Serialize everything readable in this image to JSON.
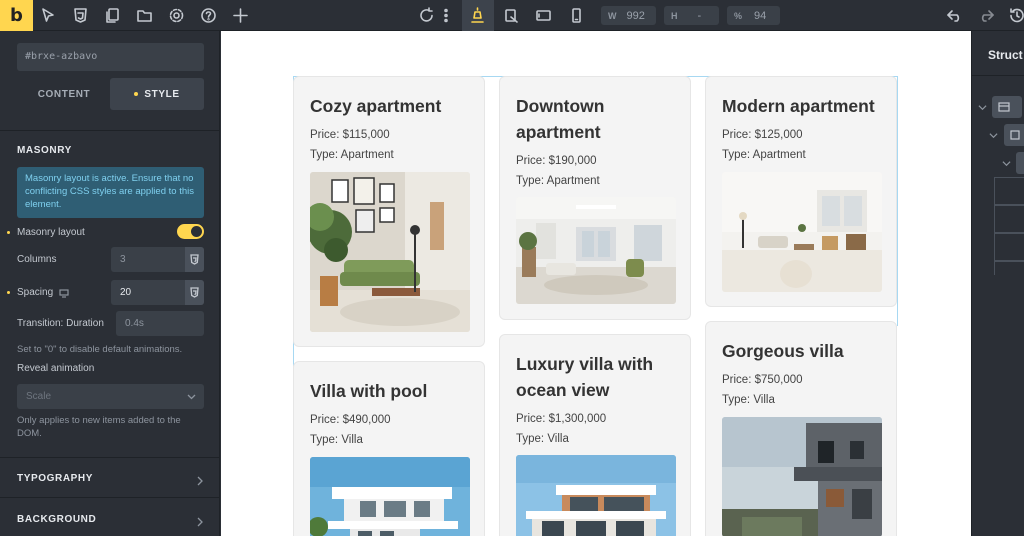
{
  "toolbar": {
    "logo": "b",
    "width_label": "W",
    "width_value": "992",
    "height_label": "H",
    "height_value": "-",
    "percent_label": "%",
    "percent_value": "94"
  },
  "left_panel": {
    "element_id": "#brxe-azbavo",
    "tabs": {
      "content": "CONTENT",
      "style": "STYLE"
    },
    "section_masonry": "MASONRY",
    "notice": "Masonry layout is active. Ensure that no conflicting CSS styles are applied to this element.",
    "masonry_layout_label": "Masonry layout",
    "columns_label": "Columns",
    "columns_value": "3",
    "spacing_label": "Spacing",
    "spacing_value": "20",
    "transition_label": "Transition: Duration",
    "transition_value": "0.4s",
    "transition_hint": "Set to \"0\" to disable default animations.",
    "reveal_label": "Reveal animation",
    "reveal_value": "Scale",
    "reveal_hint": "Only applies to new items added to the DOM.",
    "section_typography": "TYPOGRAPHY",
    "section_background": "BACKGROUND"
  },
  "right_panel": {
    "title": "Struct"
  },
  "cards": [
    {
      "title": "Cozy apartment",
      "price": "Price: $115,000",
      "type": "Type: Apartment"
    },
    {
      "title": "Downtown apartment",
      "price": "Price: $190,000",
      "type": "Type: Apartment"
    },
    {
      "title": "Modern apartment",
      "price": "Price: $125,000",
      "type": "Type: Apartment"
    },
    {
      "title": "Villa with pool",
      "price": "Price: $490,000",
      "type": "Type: Villa"
    },
    {
      "title": "Luxury villa with ocean view",
      "price": "Price: $1,300,000",
      "type": "Type: Villa"
    },
    {
      "title": "Gorgeous villa",
      "price": "Price: $750,000",
      "type": "Type: Villa"
    }
  ],
  "colors": {
    "accent": "#ffd64f",
    "panel": "#2b2f36",
    "notice_bg": "#2f5e74",
    "notice_text": "#7fd0ef"
  }
}
